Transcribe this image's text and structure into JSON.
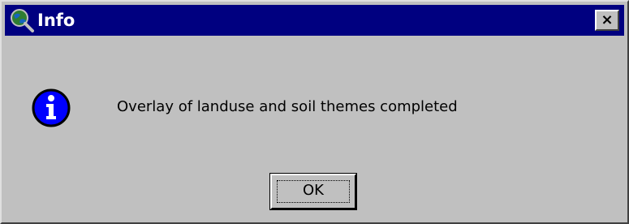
{
  "window": {
    "title": "Info",
    "close_label": "×",
    "icon": "globe-magnifier-icon"
  },
  "content": {
    "icon": "info-icon",
    "message": "Overlay of landuse and soil themes completed"
  },
  "buttons": {
    "ok_label": "OK"
  },
  "colors": {
    "titlebar": "#000080",
    "face": "#c0c0c0",
    "info_blue": "#0000ff"
  }
}
